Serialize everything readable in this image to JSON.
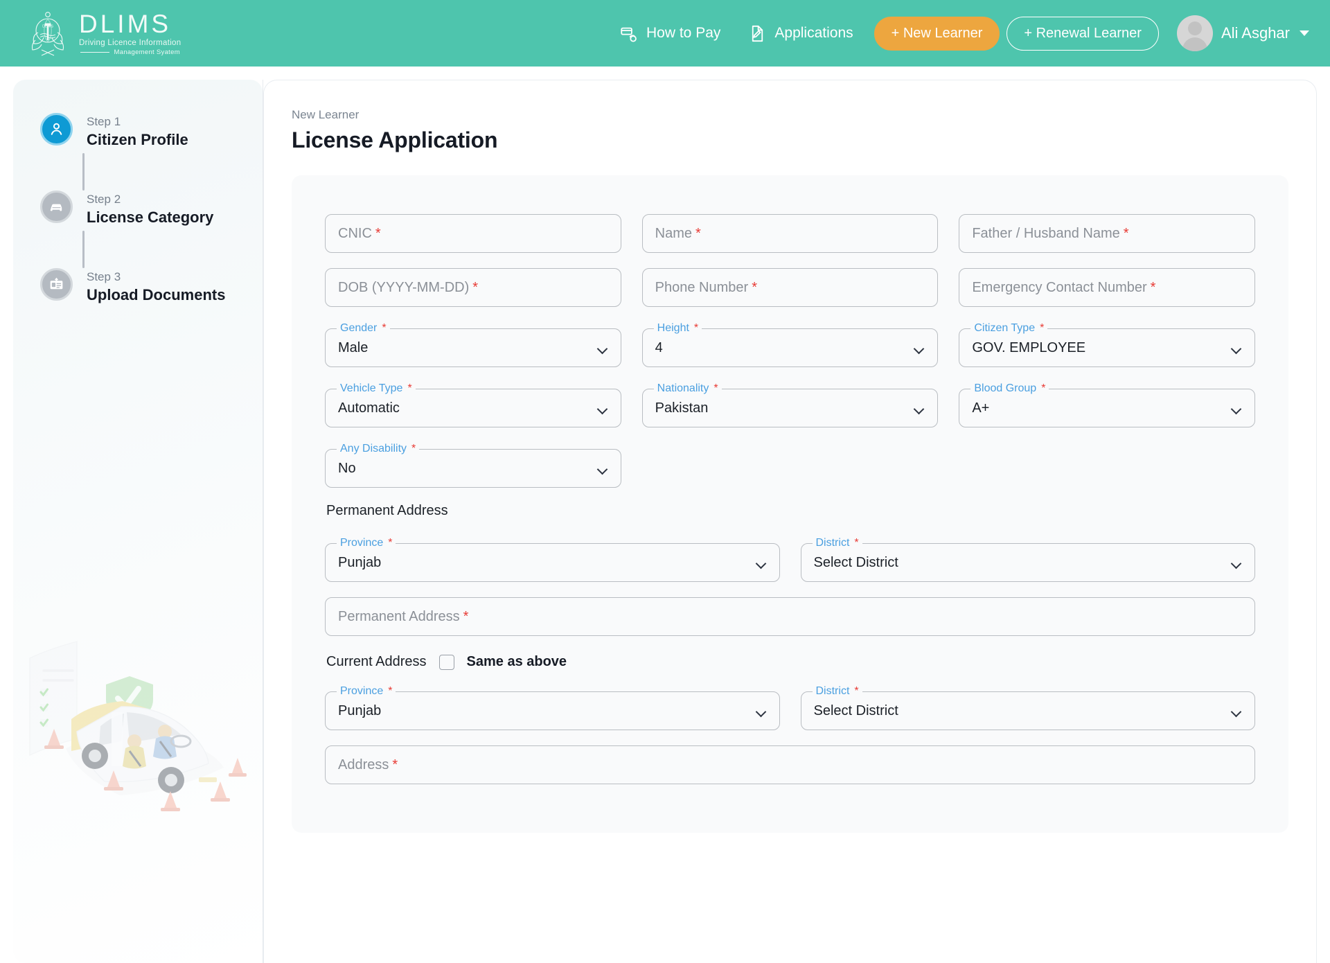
{
  "brand": {
    "title": "DLIMS",
    "subtitle_line1": "Driving Licence Information",
    "subtitle_line2": "Management Syatem",
    "crest_icon": "government-crest-icon"
  },
  "header": {
    "nav": [
      {
        "label": "How to Pay",
        "icon": "hand-card-pay-icon"
      },
      {
        "label": "Applications",
        "icon": "document-pen-icon"
      }
    ],
    "new_learner_button": "+ New Learner",
    "renewal_learner_button": "+ Renewal Learner",
    "user_name": "Ali Asghar",
    "avatar_icon": "user-avatar-icon",
    "caret_icon": "chevron-down-icon",
    "accent_color": "#4ec5ad",
    "primary_button_color": "#eda63f"
  },
  "sidebar": {
    "steps": [
      {
        "label": "Step 1",
        "name": "Citizen Profile",
        "icon": "person-icon",
        "state": "active"
      },
      {
        "label": "Step 2",
        "name": "License Category",
        "icon": "car-icon",
        "state": "inactive"
      },
      {
        "label": "Step 3",
        "name": "Upload Documents",
        "icon": "id-card-upload-icon",
        "state": "inactive"
      }
    ],
    "illustration_icon": "driving-test-car-illustration",
    "active_color": "#0e9ad4",
    "inactive_color": "#b4bac1"
  },
  "main": {
    "breadcrumb": "New Learner",
    "title": "License Application",
    "required_marker": "*",
    "fields": {
      "cnic": {
        "placeholder": "CNIC"
      },
      "name": {
        "placeholder": "Name"
      },
      "father_husband_name": {
        "placeholder": "Father / Husband Name"
      },
      "dob": {
        "placeholder": "DOB (YYYY-MM-DD)"
      },
      "phone_number": {
        "placeholder": "Phone Number"
      },
      "emergency_contact_number": {
        "placeholder": "Emergency Contact Number"
      },
      "gender": {
        "label": "Gender",
        "value": "Male"
      },
      "height": {
        "label": "Height",
        "value": "4"
      },
      "citizen_type": {
        "label": "Citizen Type",
        "value": "GOV. EMPLOYEE"
      },
      "vehicle_type": {
        "label": "Vehicle Type",
        "value": "Automatic"
      },
      "nationality": {
        "label": "Nationality",
        "value": "Pakistan"
      },
      "blood_group": {
        "label": "Blood Group",
        "value": "A+"
      },
      "any_disability": {
        "label": "Any Disability",
        "value": "No"
      }
    },
    "permanent_address": {
      "section_title": "Permanent Address",
      "province": {
        "label": "Province",
        "value": "Punjab"
      },
      "district": {
        "label": "District",
        "value": "Select District"
      },
      "address": {
        "placeholder": "Permanent Address"
      }
    },
    "current_address": {
      "section_title": "Current Address",
      "same_as_above_label": "Same as above",
      "same_as_above_checked": false,
      "province": {
        "label": "Province",
        "value": "Punjab"
      },
      "district": {
        "label": "District",
        "value": "Select District"
      },
      "address": {
        "placeholder": "Address"
      }
    }
  }
}
